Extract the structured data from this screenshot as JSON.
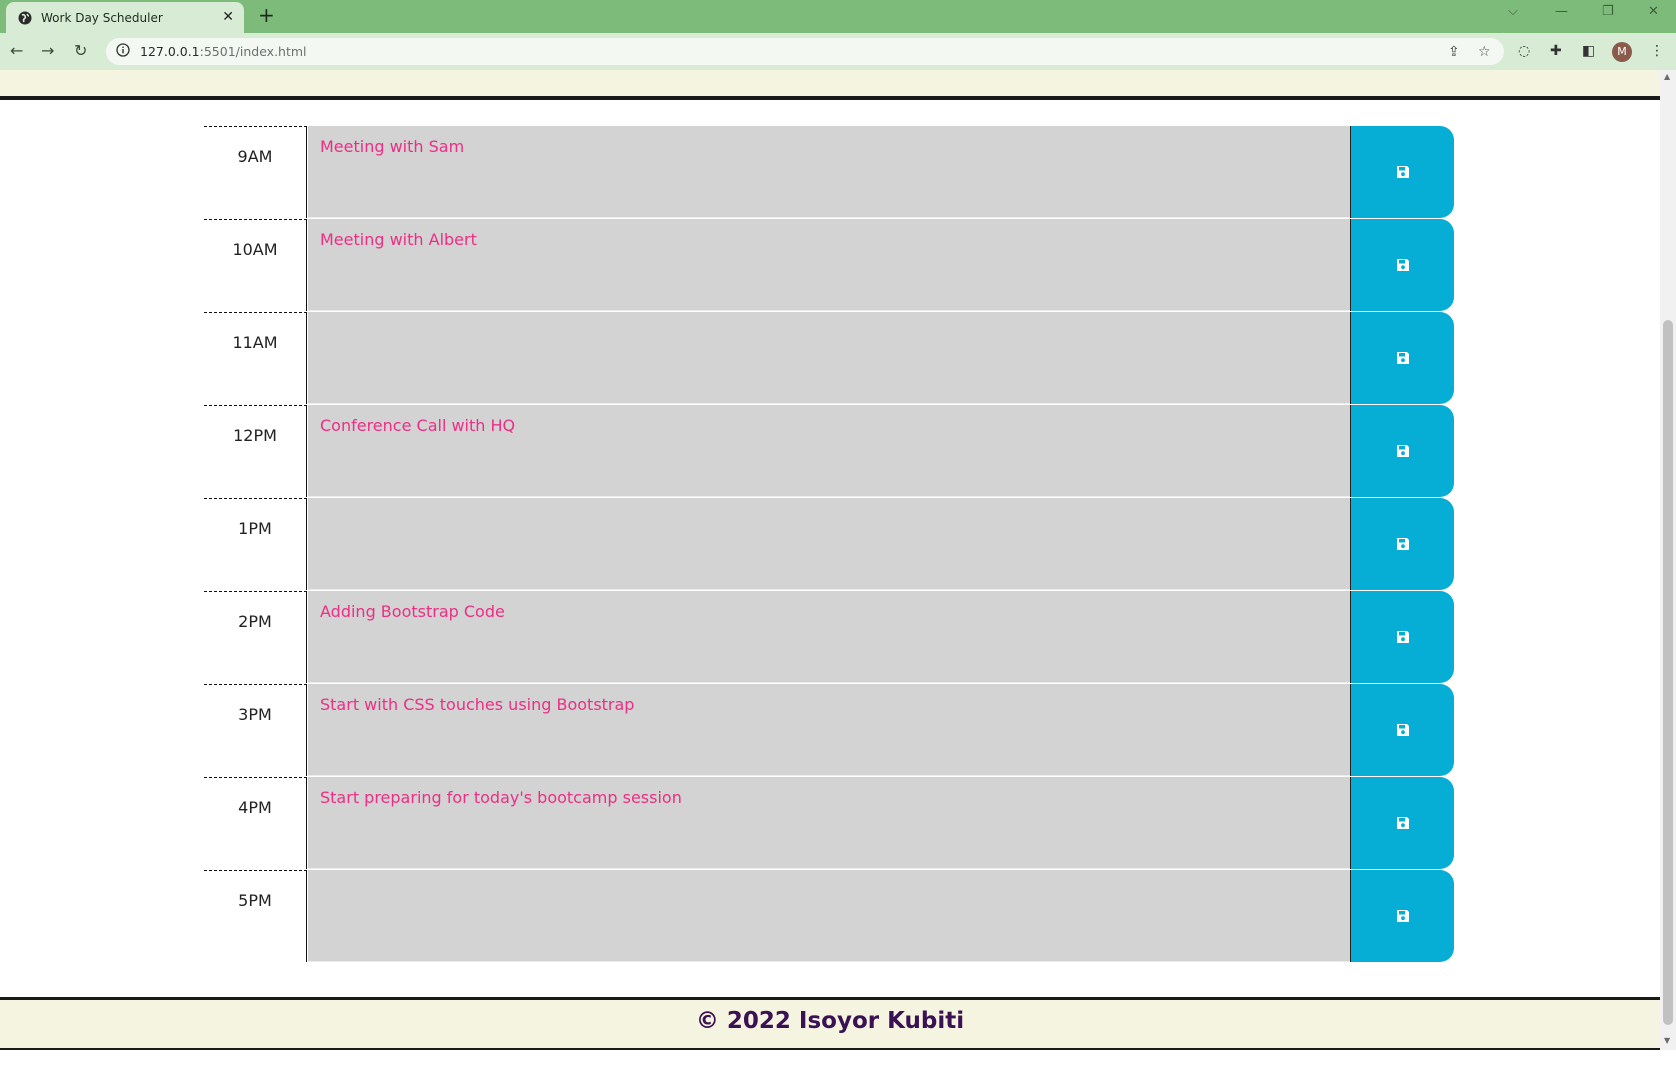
{
  "browser": {
    "tab_title": "Work Day Scheduler",
    "tab_close": "✕",
    "new_tab": "+",
    "url_host": "127.0.0.1",
    "url_rest": ":5501/index.html",
    "profile_initial": "M"
  },
  "schedule": {
    "rows": [
      {
        "hour": "9AM",
        "text": "Meeting with Sam"
      },
      {
        "hour": "10AM",
        "text": "Meeting with Albert"
      },
      {
        "hour": "11AM",
        "text": ""
      },
      {
        "hour": "12PM",
        "text": "Conference Call with HQ"
      },
      {
        "hour": "1PM",
        "text": ""
      },
      {
        "hour": "2PM",
        "text": "Adding Bootstrap Code"
      },
      {
        "hour": "3PM",
        "text": "Start with CSS touches using Bootstrap"
      },
      {
        "hour": "4PM",
        "text": "Start preparing for today's bootcamp session"
      },
      {
        "hour": "5PM",
        "text": ""
      }
    ],
    "save_icon": "save-icon"
  },
  "footer": {
    "copyright": "© 2022 Isoyor Kubiti"
  },
  "colors": {
    "tabbar": "#7dbb7a",
    "description_bg": "#d3d3d3",
    "description_text": "#ec2e86",
    "save_button": "#06aed5",
    "footer_bg": "#f5f4e0",
    "footer_text": "#3a1253"
  }
}
